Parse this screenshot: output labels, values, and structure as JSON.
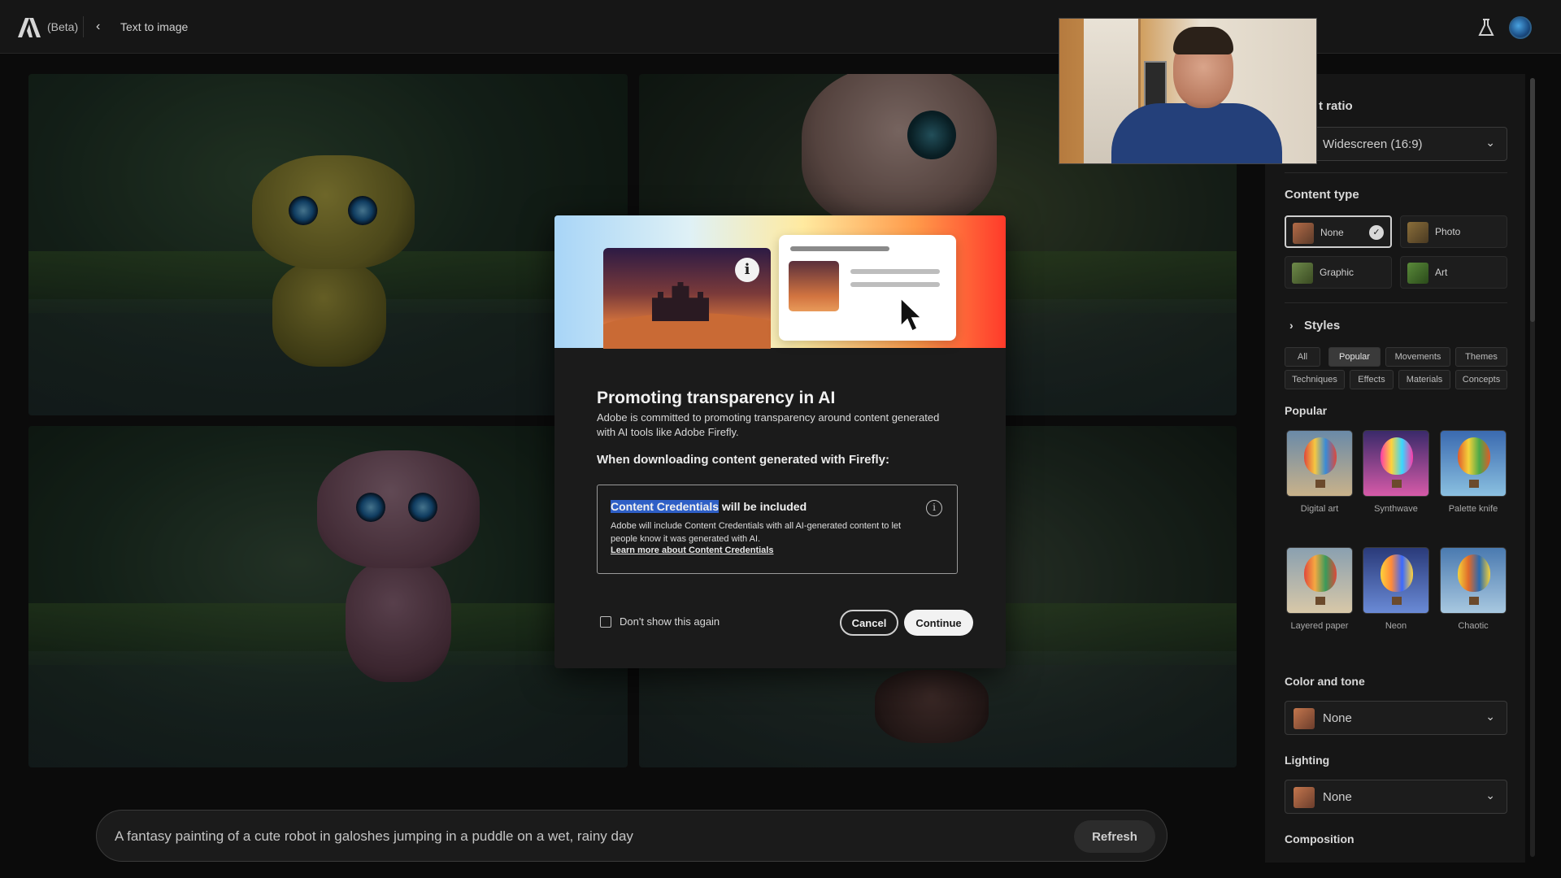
{
  "header": {
    "beta_label": "(Beta)",
    "back_glyph": "‹",
    "breadcrumb": "Text to image"
  },
  "prompt": {
    "text": "A fantasy painting of a cute robot in galoshes jumping in a puddle on a wet, rainy day",
    "refresh_label": "Refresh"
  },
  "panel": {
    "aspect_ratio": {
      "label": "t ratio",
      "value": "Widescreen (16:9)"
    },
    "content_type": {
      "label": "Content type",
      "options": [
        {
          "label": "None",
          "selected": true
        },
        {
          "label": "Photo",
          "selected": false
        },
        {
          "label": "Graphic",
          "selected": false
        },
        {
          "label": "Art",
          "selected": false
        }
      ]
    },
    "styles": {
      "label": "Styles",
      "chips": [
        {
          "label": "All",
          "active": false
        },
        {
          "label": "Popular",
          "active": true
        },
        {
          "label": "Movements",
          "active": false
        },
        {
          "label": "Themes",
          "active": false
        },
        {
          "label": "Techniques",
          "active": false
        },
        {
          "label": "Effects",
          "active": false
        },
        {
          "label": "Materials",
          "active": false
        },
        {
          "label": "Concepts",
          "active": false
        }
      ]
    },
    "popular": {
      "label": "Popular",
      "items": [
        {
          "label": "Digital art"
        },
        {
          "label": "Synthwave"
        },
        {
          "label": "Palette knife"
        },
        {
          "label": "Layered paper"
        },
        {
          "label": "Neon"
        },
        {
          "label": "Chaotic"
        }
      ]
    },
    "color_tone": {
      "label": "Color and tone",
      "value": "None"
    },
    "lighting": {
      "label": "Lighting",
      "value": "None"
    },
    "composition": {
      "label": "Composition"
    }
  },
  "modal": {
    "title": "Promoting transparency in AI",
    "description": "Adobe is committed to promoting transparency around content generated with AI tools like Adobe Firefly.",
    "subheading": "When downloading content generated with Firefly:",
    "cc_title_highlight": "Content Credentials",
    "cc_title_rest": " will be included",
    "cc_description": "Adobe will include Content Credentials with all AI-generated content to let people know it was generated with AI.",
    "cc_link": "Learn more about Content Credentials",
    "checkbox_label": "Don't show this again",
    "cancel_label": "Cancel",
    "continue_label": "Continue",
    "info_glyph": "i"
  },
  "colors": {
    "accent_highlight": "#2e5fc6",
    "background": "#141414",
    "modal_bg": "#1b1b1b"
  }
}
